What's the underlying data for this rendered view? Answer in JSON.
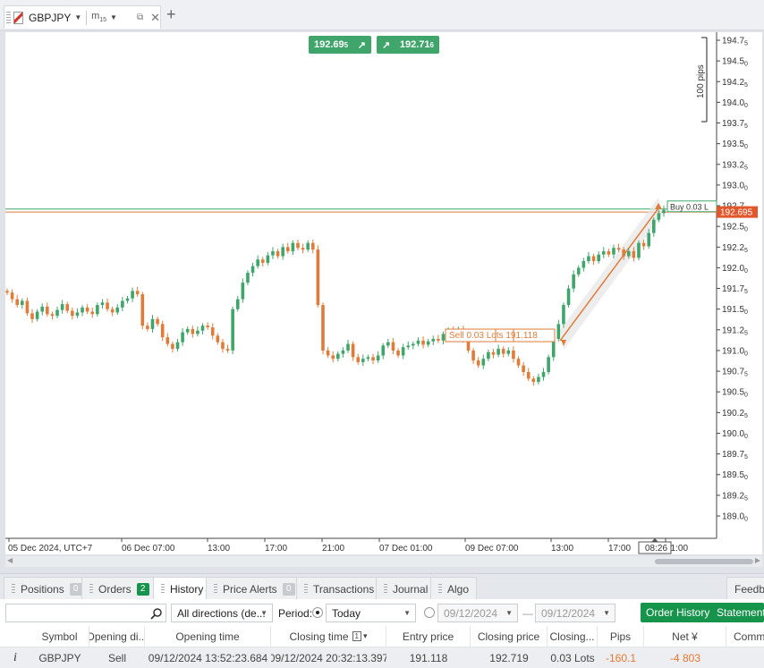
{
  "tab": {
    "symbol": "GBPJPY",
    "timeframe_main": "m",
    "timeframe_sub": "15"
  },
  "colors": {
    "bull": "#3fa56b",
    "bear": "#e07b39",
    "current_price": "#e2572b",
    "buy_order": "#3fa56b",
    "sell_order": "#e07b39"
  },
  "quotes": {
    "sell": {
      "price": "192.69",
      "pipette": "5",
      "arrow": "↗"
    },
    "buy": {
      "price": "192.71",
      "pipette": "6",
      "arrow": "↗"
    }
  },
  "chart_data": {
    "type": "candlestick",
    "symbol": "GBPJPY",
    "y_axis": {
      "range": [
        188.85,
        194.85
      ],
      "tick_labels": [
        "194.75",
        "194.50",
        "194.25",
        "194.00",
        "193.75",
        "193.50",
        "193.25",
        "193.00",
        "192.75",
        "192.50",
        "192.25",
        "192.00",
        "191.75",
        "191.50",
        "191.25",
        "191.00",
        "190.75",
        "190.50",
        "190.25",
        "190.00",
        "189.75",
        "189.50",
        "189.25",
        "189.00"
      ]
    },
    "x_axis": {
      "tick_labels": [
        "05 Dec 2024, UTC+7",
        "06 Dec 07:00",
        "13:00",
        "17:00",
        "21:00",
        "07 Dec 01:00",
        "09 Dec 07:00",
        "13:00",
        "17:00",
        "21:00"
      ],
      "cursor_label": "08:26"
    },
    "scale_label": "100 pips",
    "current_price": "192.695",
    "buy_line": {
      "price": 192.71,
      "label": "Buy  0.03 L"
    },
    "sell_line": {
      "price": 192.69
    },
    "trade": {
      "label": "Sell  0.03 Lots  191.118",
      "entry": 191.118,
      "exit": 192.719
    },
    "candles_close": [
      191.7,
      191.62,
      191.55,
      191.6,
      191.45,
      191.38,
      191.47,
      191.53,
      191.44,
      191.42,
      191.49,
      191.56,
      191.48,
      191.42,
      191.46,
      191.52,
      191.47,
      191.44,
      191.55,
      191.58,
      191.5,
      191.46,
      191.52,
      191.6,
      191.63,
      191.72,
      191.68,
      191.3,
      191.26,
      191.38,
      191.32,
      191.16,
      191.08,
      191.02,
      191.1,
      191.22,
      191.26,
      191.2,
      191.24,
      191.3,
      191.28,
      191.18,
      191.1,
      191.02,
      191.0,
      191.5,
      191.62,
      191.82,
      191.94,
      192.02,
      192.1,
      192.06,
      192.15,
      192.2,
      192.14,
      192.25,
      192.2,
      192.3,
      192.24,
      192.22,
      192.3,
      192.22,
      191.55,
      191.0,
      190.94,
      190.9,
      190.96,
      191.0,
      191.08,
      190.92,
      190.86,
      190.9,
      190.92,
      190.88,
      190.94,
      191.06,
      191.1,
      191.0,
      190.94,
      191.04,
      191.06,
      191.08,
      191.12,
      191.07,
      191.11,
      191.14,
      191.12,
      191.2,
      191.24,
      191.22,
      191.26,
      191.14,
      191.0,
      190.88,
      190.82,
      190.9,
      190.98,
      190.95,
      191.02,
      190.96,
      191.0,
      190.9,
      190.82,
      190.74,
      190.66,
      190.62,
      190.68,
      190.74,
      190.92,
      191.14,
      191.32,
      191.55,
      191.75,
      191.92,
      192.0,
      192.08,
      192.14,
      192.08,
      192.16,
      192.2,
      192.16,
      192.24,
      192.22,
      192.14,
      192.2,
      192.12,
      192.3,
      192.26,
      192.42,
      192.58,
      192.66,
      192.7
    ]
  },
  "bottom_tabs": [
    {
      "label": "Positions",
      "badge": "0",
      "active": false
    },
    {
      "label": "Orders",
      "badge": "2",
      "active": false,
      "badge_color": "green"
    },
    {
      "label": "History",
      "badge": "",
      "active": true
    },
    {
      "label": "Price Alerts",
      "badge": "0",
      "active": false
    },
    {
      "label": "Transactions",
      "badge": "",
      "active": false
    },
    {
      "label": "Journal",
      "badge": "",
      "active": false
    },
    {
      "label": "Algo",
      "badge": "",
      "active": false
    }
  ],
  "feedback_label": "Feedba",
  "filters": {
    "search_value": "",
    "direction": "All directions (de...",
    "period_label": "Period:",
    "period": "Today",
    "date_from": "09/12/2024",
    "date_sep": "—",
    "date_to": "09/12/2024",
    "order_history_button": "Order History",
    "statement_button": "Statement"
  },
  "table": {
    "columns": [
      "Symbol",
      "Opening di...",
      "Opening time",
      "Closing time",
      "Entry price",
      "Closing price",
      "Closing...",
      "Pips",
      "Net ¥",
      "Comme"
    ],
    "sort_indicator": "1",
    "sort_arrow": "▾",
    "rows": [
      {
        "info": "i",
        "symbol": "GBPJPY",
        "direction": "Sell",
        "opening_time": "09/12/2024 13:52:23.684",
        "closing_time": "09/12/2024 20:32:13.397",
        "entry_price": "191.118",
        "closing_price": "192.719",
        "closing_volume": "0.03 Lots",
        "pips": "-160.1",
        "net": "-4 803",
        "comment": ""
      }
    ]
  }
}
